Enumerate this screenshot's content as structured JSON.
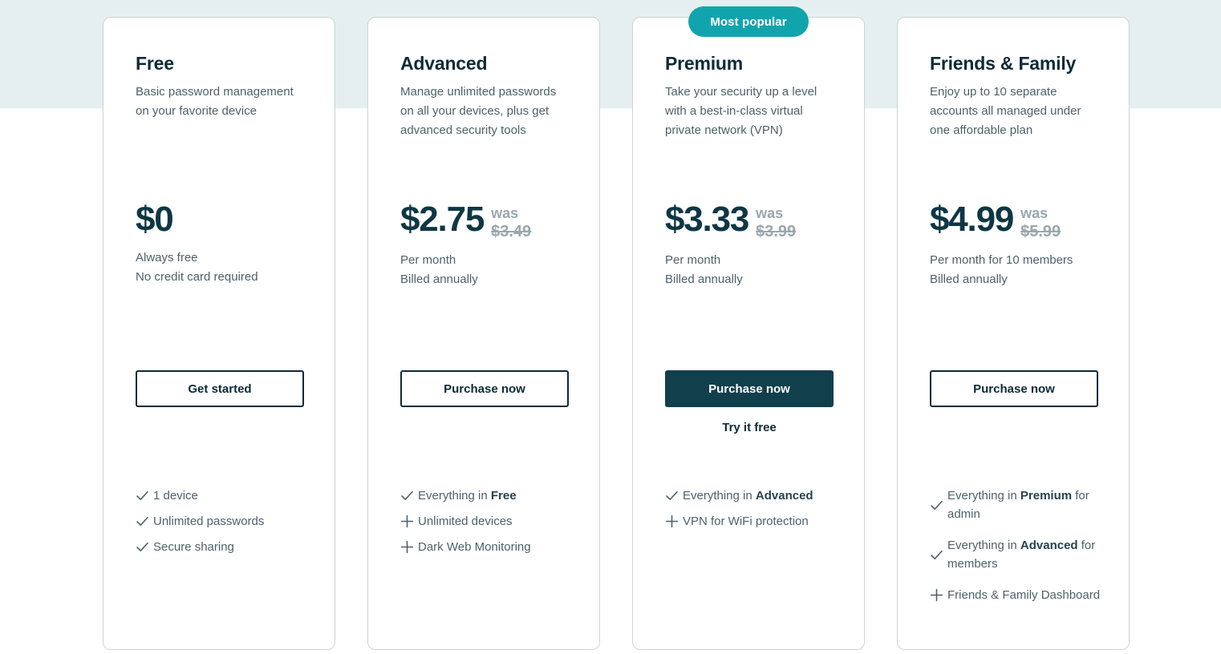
{
  "theme": {
    "band_color": "#e6eff0",
    "card_border": "#cdd3d6",
    "badge_color": "#12a4ad",
    "heading_color": "#0e2a38",
    "body_color": "#4d616c",
    "price_color": "#0e3744",
    "was_color": "#9aa7ad",
    "filled_button_color": "#123f4c"
  },
  "badge": {
    "label": "Most popular"
  },
  "plans": [
    {
      "name": "Free",
      "description": "Basic password management on your favorite device",
      "price": "$0",
      "was_label": "",
      "was_amount": "",
      "sub_line1": "Always free",
      "sub_line2": "No credit card required",
      "cta_label": "Get started",
      "cta_style": "outline",
      "secondary_cta": "",
      "features": [
        {
          "icon": "check-icon",
          "text": "1 device",
          "bold": ""
        },
        {
          "icon": "check-icon",
          "text": "Unlimited passwords",
          "bold": ""
        },
        {
          "icon": "check-icon",
          "text": "Secure sharing",
          "bold": ""
        }
      ]
    },
    {
      "name": "Advanced",
      "description": "Manage unlimited passwords on all your devices, plus get advanced security tools",
      "price": "$2.75",
      "was_label": "was",
      "was_amount": "$3.49",
      "sub_line1": "Per month",
      "sub_line2": "Billed annually",
      "cta_label": "Purchase now",
      "cta_style": "outline",
      "secondary_cta": "",
      "features": [
        {
          "icon": "check-icon",
          "text": "Everything in ",
          "bold": "Free"
        },
        {
          "icon": "plus-icon",
          "text": "Unlimited devices",
          "bold": ""
        },
        {
          "icon": "plus-icon",
          "text": "Dark Web Monitoring",
          "bold": ""
        }
      ]
    },
    {
      "name": "Premium",
      "description": "Take your security up a level with a best-in-class virtual private network (VPN)",
      "price": "$3.33",
      "was_label": "was",
      "was_amount": "$3.99",
      "sub_line1": "Per month",
      "sub_line2": "Billed annually",
      "cta_label": "Purchase now",
      "cta_style": "filled",
      "secondary_cta": "Try it free",
      "features": [
        {
          "icon": "check-icon",
          "text": "Everything in ",
          "bold": "Advanced"
        },
        {
          "icon": "plus-icon",
          "text": "VPN for WiFi protection",
          "bold": ""
        }
      ]
    },
    {
      "name": "Friends & Family",
      "description": "Enjoy up to 10 separate accounts all managed under one affordable plan",
      "price": "$4.99",
      "was_label": "was",
      "was_amount": "$5.99",
      "sub_line1": "Per month for 10 members",
      "sub_line2": "Billed annually",
      "cta_label": "Purchase now",
      "cta_style": "outline",
      "secondary_cta": "",
      "features": [
        {
          "icon": "check-icon",
          "text": "Everything in ",
          "bold": "Premium",
          "text_after": " for admin"
        },
        {
          "icon": "check-icon",
          "text": "Everything in ",
          "bold": "Advanced",
          "text_after": " for members"
        },
        {
          "icon": "plus-icon",
          "text": "Friends & Family Dashboard",
          "bold": ""
        }
      ]
    }
  ]
}
